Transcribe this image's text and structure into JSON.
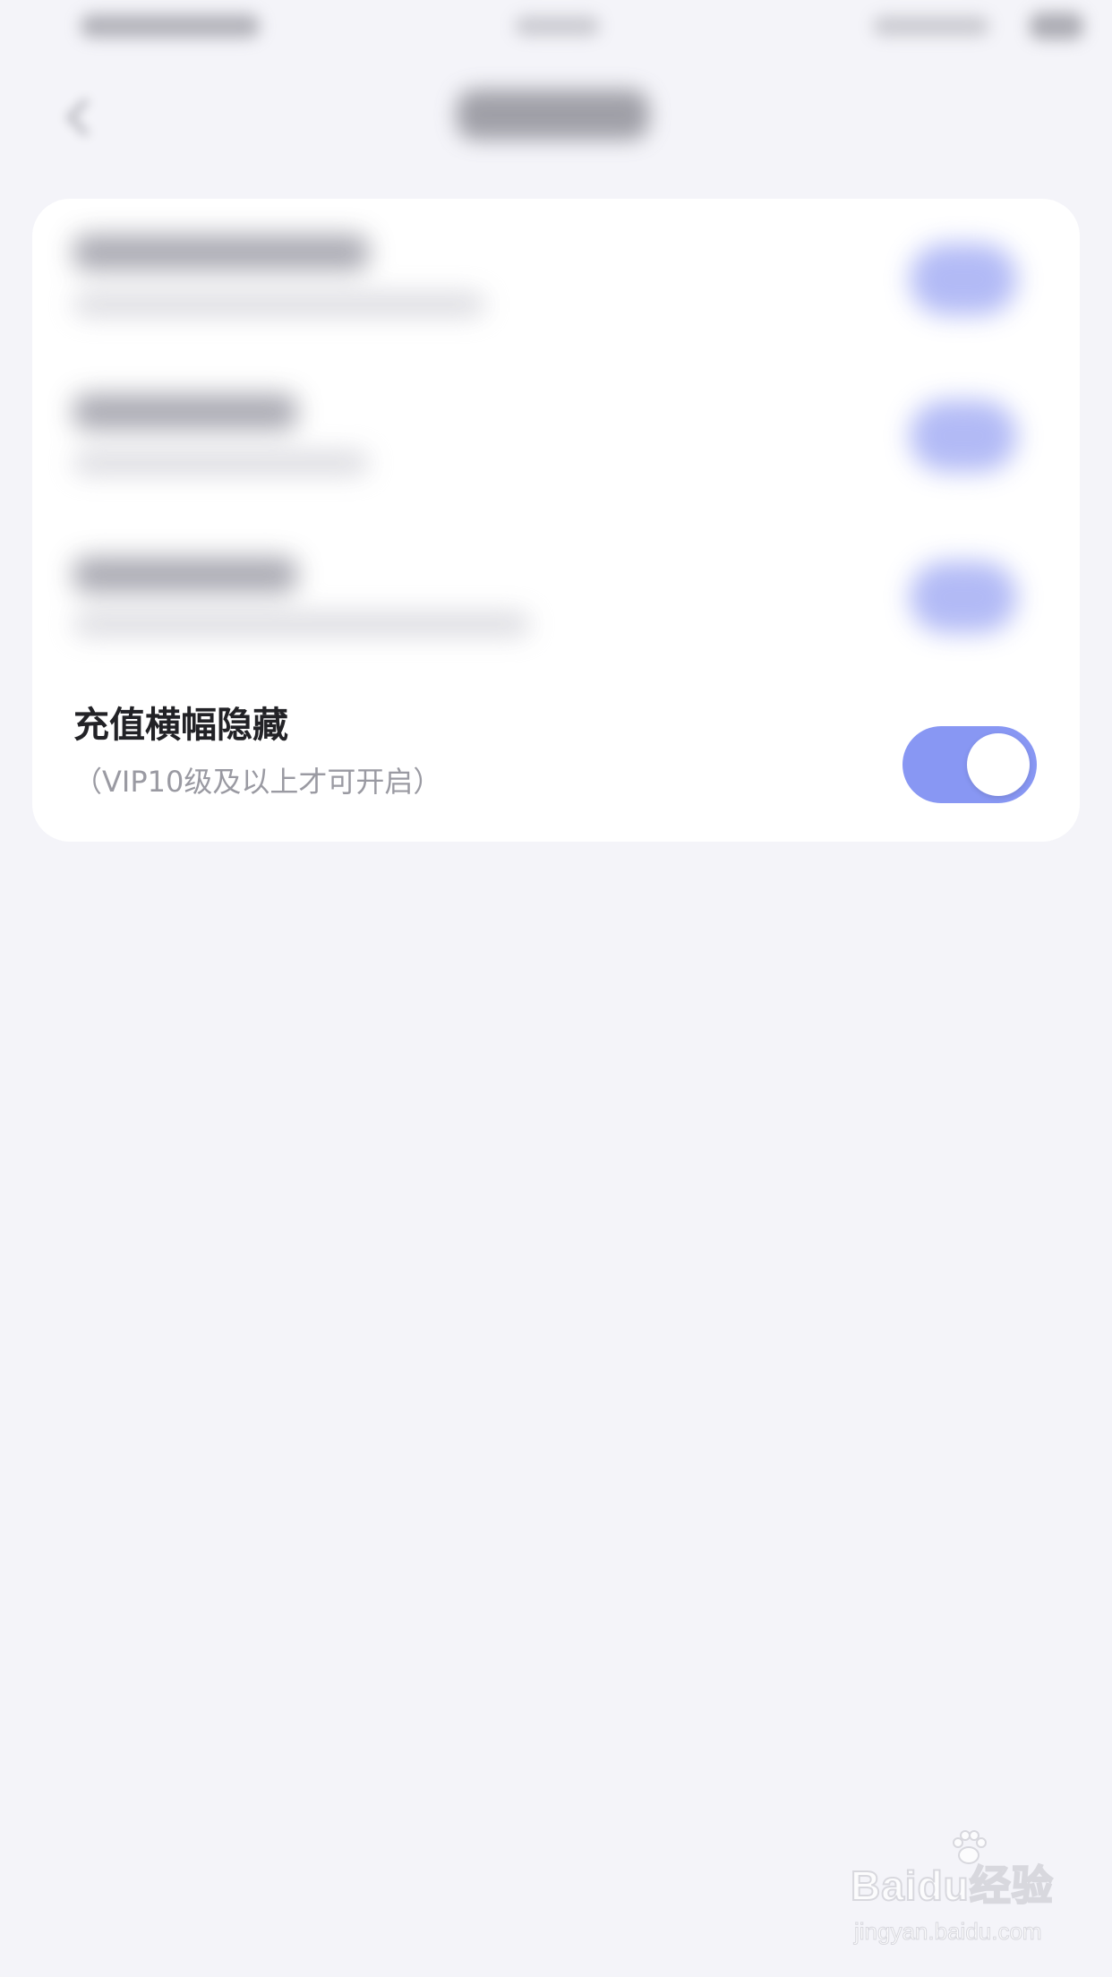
{
  "settings_item": {
    "title": "充值横幅隐藏",
    "subtitle": "（VIP10级及以上才可开启）",
    "toggle_on": true,
    "toggle_color": "#8897f3"
  },
  "watermark": {
    "logo": "Baidu经验",
    "url": "jingyan.baidu.com"
  },
  "colors": {
    "background": "#f4f4f9",
    "card": "#ffffff",
    "title_text": "#222226",
    "subtitle_text": "#9a9aa2"
  }
}
